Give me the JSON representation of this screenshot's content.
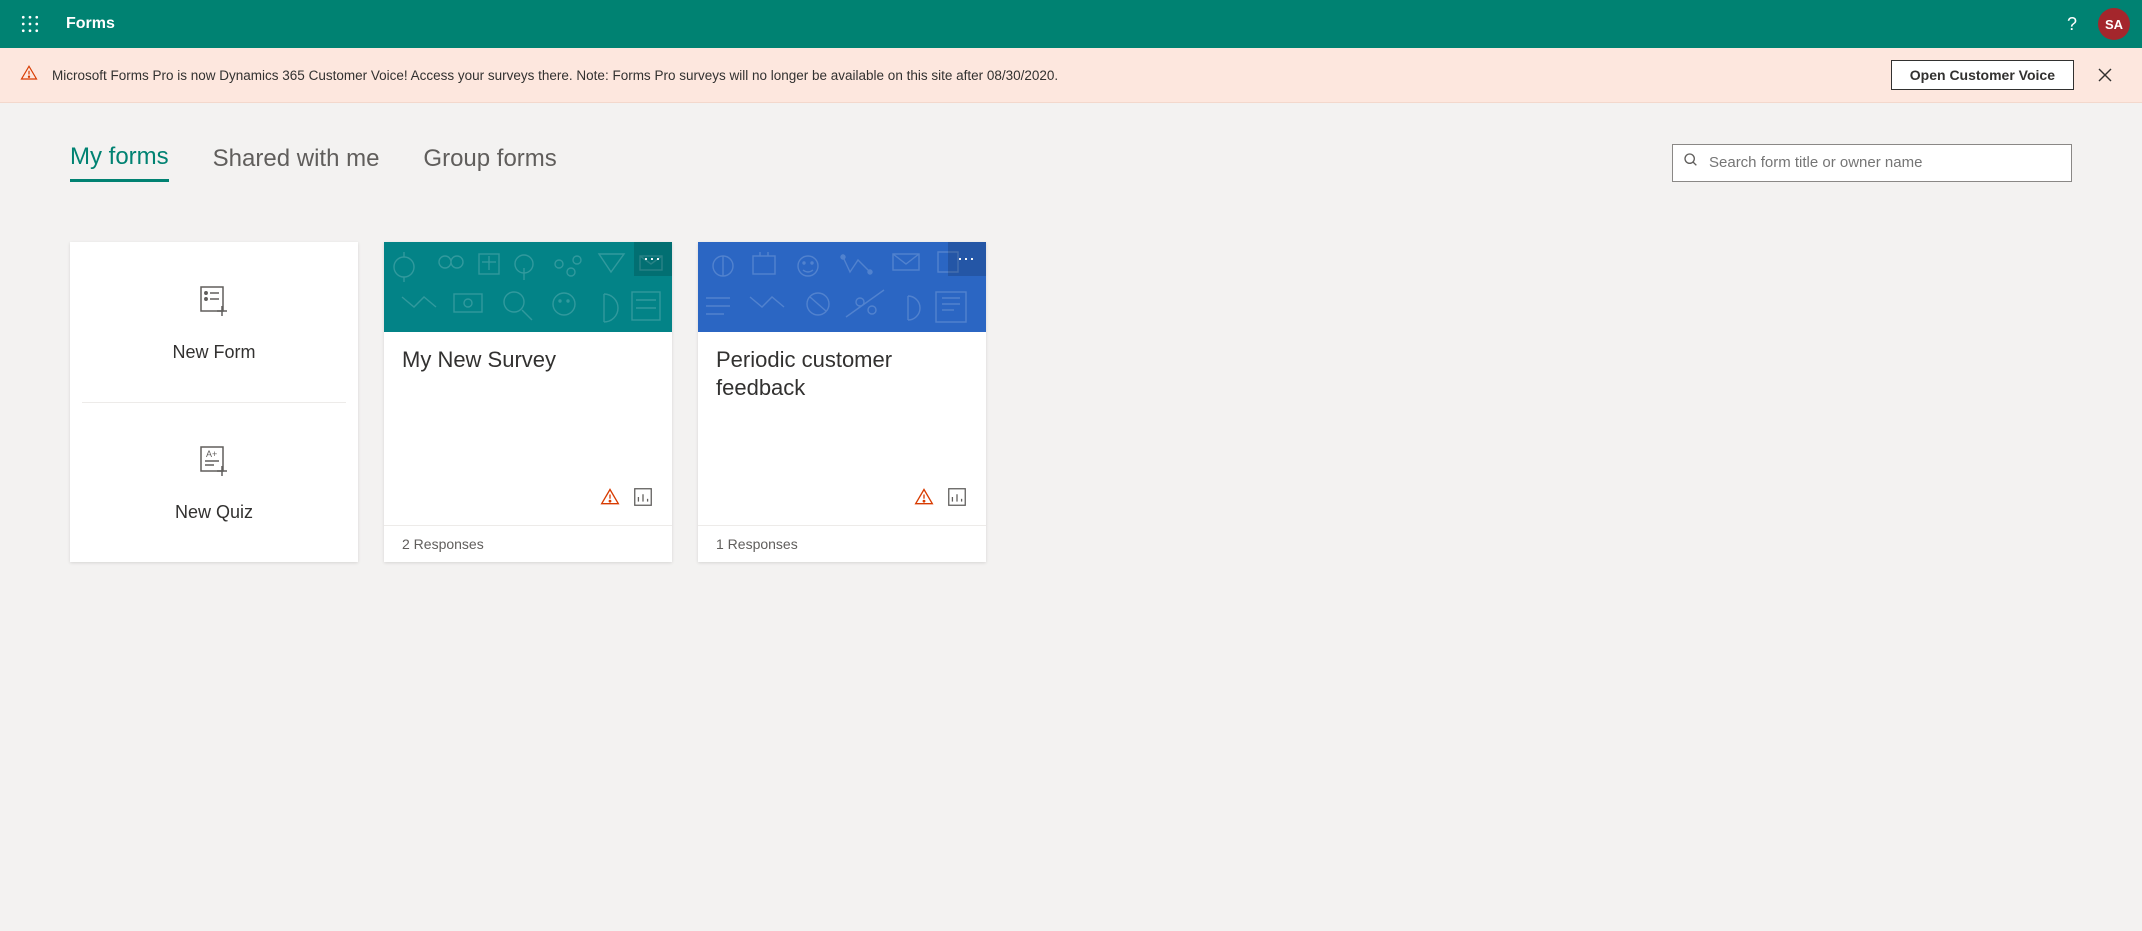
{
  "header": {
    "app_title": "Forms",
    "avatar_initials": "SA"
  },
  "banner": {
    "text": "Microsoft Forms Pro is now Dynamics 365 Customer Voice! Access your surveys there. Note: Forms Pro surveys will no longer be available on this site after 08/30/2020.",
    "button_label": "Open Customer Voice"
  },
  "tabs": [
    {
      "label": "My forms",
      "active": true
    },
    {
      "label": "Shared with me",
      "active": false
    },
    {
      "label": "Group forms",
      "active": false
    }
  ],
  "search": {
    "placeholder": "Search form title or owner name"
  },
  "new_card": {
    "form_label": "New Form",
    "quiz_label": "New Quiz"
  },
  "forms": [
    {
      "title": "My New Survey",
      "responses_text": "2 Responses",
      "header_color": "teal"
    },
    {
      "title": "Periodic customer feedback",
      "responses_text": "1 Responses",
      "header_color": "blue"
    }
  ]
}
